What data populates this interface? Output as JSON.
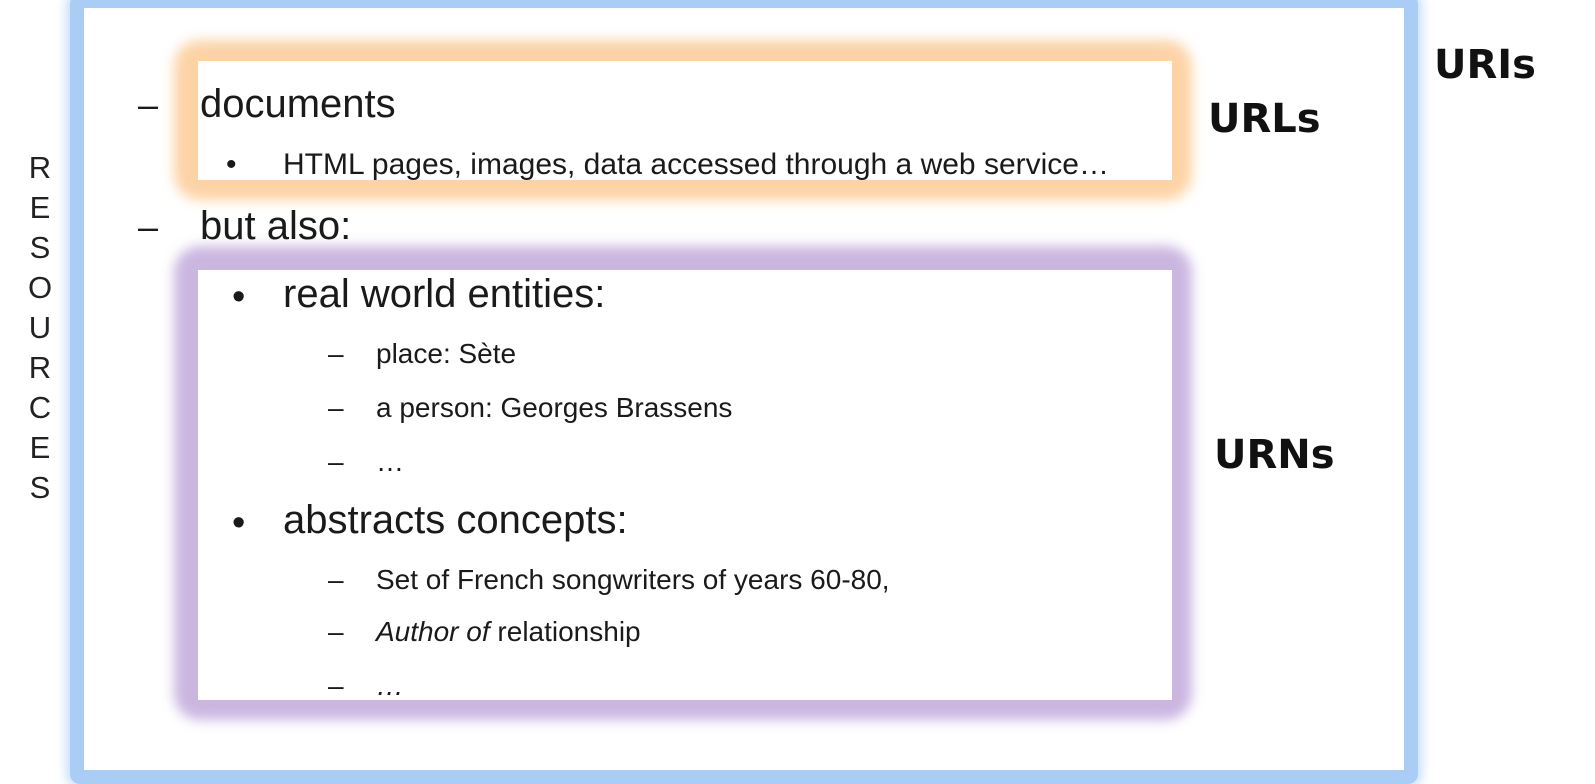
{
  "labels": {
    "uris": "URIs",
    "urls": "URLs",
    "urns": "URNs"
  },
  "side_letters": [
    "R",
    "E",
    "S",
    "O",
    "U",
    "R",
    "C",
    "E",
    "S"
  ],
  "markers": {
    "dash": "–",
    "bullet": "•"
  },
  "documents": {
    "title": "documents",
    "detail": "HTML pages, images, data accessed through a web service…"
  },
  "but_also": {
    "title": "but also:",
    "real_world": {
      "title": "real world entities:",
      "items": [
        "place: Sète",
        "a person: Georges Brassens",
        "…"
      ]
    },
    "abstract": {
      "title": "abstracts concepts:",
      "item1": "Set of French songwriters of years 60-80,",
      "item2_italic": "Author of",
      "item2_rest": " relationship",
      "item3": "…"
    }
  },
  "colors": {
    "uri_frame": "#aacdf5",
    "url_box": "#fdd3a6",
    "urn_box": "#cbb6e0"
  }
}
